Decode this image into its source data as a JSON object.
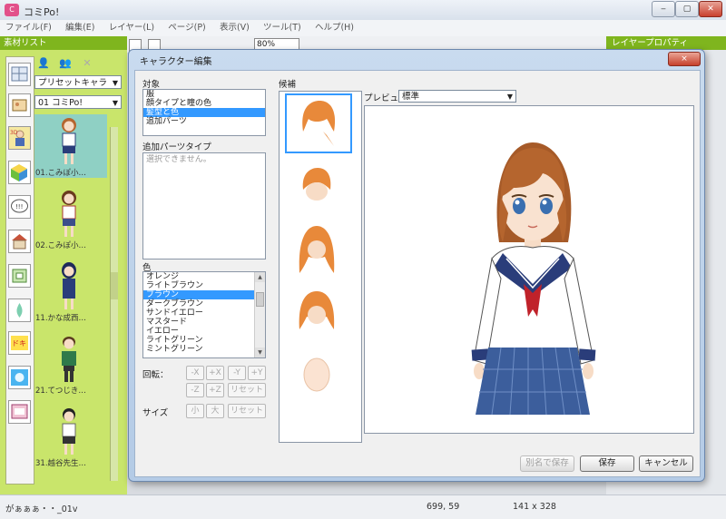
{
  "window": {
    "title": "コミPo!",
    "logo_text": "C"
  },
  "menu": [
    "ファイル(F)",
    "編集(E)",
    "レイヤー(L)",
    "ページ(P)",
    "表示(V)",
    "ツール(T)",
    "ヘルプ(H)"
  ],
  "toolbar": {
    "zoom": "80%"
  },
  "left_panel": {
    "header": "素材リスト",
    "preset_combo": "プリセットキャラ",
    "char_combo": "01 コミPo!",
    "characters": [
      {
        "name": "01.こみぽ小…",
        "selected": true
      },
      {
        "name": "02.こみぽ小…",
        "selected": false
      },
      {
        "name": "11.かな成西…",
        "selected": false
      },
      {
        "name": "21.てつじき…",
        "selected": false
      },
      {
        "name": "31.越谷先生…",
        "selected": false
      }
    ]
  },
  "right_panel": {
    "header": "レイヤープロパティ"
  },
  "status": {
    "left": "がぁぁぁ・・_01v",
    "coords": "699, 59",
    "size": "141 x 328"
  },
  "dialog": {
    "title": "キャラクター編集",
    "target_label": "対象",
    "targets": [
      {
        "label": "服",
        "selected": false
      },
      {
        "label": "顔タイプと瞳の色",
        "selected": false
      },
      {
        "label": "髪型と色",
        "selected": true
      },
      {
        "label": "追加パーツ",
        "selected": false
      }
    ],
    "extra_parts_label": "追加パーツタイプ",
    "extra_parts_placeholder": "選択できません。",
    "color_label": "色",
    "colors": [
      {
        "label": "オレンジ",
        "selected": false
      },
      {
        "label": "ライトブラウン",
        "selected": false
      },
      {
        "label": "ブラウン",
        "selected": true
      },
      {
        "label": "ダークブラウン",
        "selected": false
      },
      {
        "label": "サンドイエロー",
        "selected": false
      },
      {
        "label": "マスタード",
        "selected": false
      },
      {
        "label": "イエロー",
        "selected": false
      },
      {
        "label": "ライトグリーン",
        "selected": false
      },
      {
        "label": "ミントグリーン",
        "selected": false
      }
    ],
    "rotate_label": "回転：",
    "rotate_buttons": [
      "-X",
      "+X",
      "-Y",
      "+Y",
      "-Z",
      "+Z",
      "リセット"
    ],
    "size_label": "サイズ",
    "size_buttons": [
      "小",
      "大",
      "リセット"
    ],
    "candidates_label": "候補",
    "preview_label": "プレビュ",
    "preview_combo": "標準",
    "save_as_button": "別名で保存",
    "save_button": "保存",
    "cancel_button": "キャンセル",
    "close_button": "×"
  },
  "colors": {
    "panel_green": "#c9e56b",
    "header_green": "#7fb51e",
    "selection_blue": "#3399ff",
    "hair_brown": "#b5652e",
    "uniform_navy": "#2a3d7a"
  }
}
